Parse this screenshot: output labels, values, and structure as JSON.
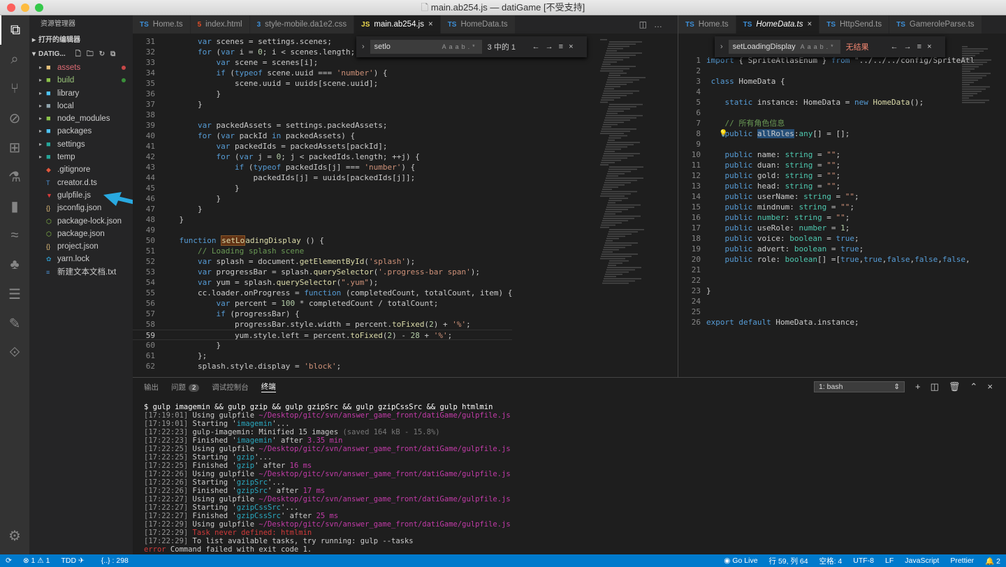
{
  "window": {
    "title": "main.ab254.js — datiGame [不受支持]"
  },
  "sidebar": {
    "title": "资源管理器",
    "open_editors": "打开的编辑器",
    "folder": "DATIG...",
    "items": [
      {
        "label": "assets",
        "type": "folder",
        "color": "#e5c07b",
        "dot": "#c74848"
      },
      {
        "label": "build",
        "type": "folder",
        "color": "#8bc34a",
        "dot": "#3a8f3a"
      },
      {
        "label": "library",
        "type": "folder",
        "color": "#4fc3f7"
      },
      {
        "label": "local",
        "type": "folder",
        "color": "#90a4ae"
      },
      {
        "label": "node_modules",
        "type": "folder",
        "color": "#8bc34a"
      },
      {
        "label": "packages",
        "type": "folder",
        "color": "#4fc3f7"
      },
      {
        "label": "settings",
        "type": "folder",
        "color": "#26a69a"
      },
      {
        "label": "temp",
        "type": "folder",
        "color": "#26a69a"
      },
      {
        "label": ".gitignore",
        "type": "file",
        "icon": "git-icon"
      },
      {
        "label": "creator.d.ts",
        "type": "file",
        "icon": "ts-icon"
      },
      {
        "label": "gulpfile.js",
        "type": "file",
        "icon": "gulp-icon"
      },
      {
        "label": "jsconfig.json",
        "type": "file",
        "icon": "json-icon"
      },
      {
        "label": "package-lock.json",
        "type": "file",
        "icon": "npm-icon"
      },
      {
        "label": "package.json",
        "type": "file",
        "icon": "npm-icon"
      },
      {
        "label": "project.json",
        "type": "file",
        "icon": "json-icon"
      },
      {
        "label": "yarn.lock",
        "type": "file",
        "icon": "yarn-icon"
      },
      {
        "label": "新建文本文档.txt",
        "type": "file",
        "icon": "txt-icon"
      }
    ]
  },
  "editor1": {
    "tabs": [
      {
        "label": "Home.ts",
        "icon": "TS"
      },
      {
        "label": "index.html",
        "icon": "5"
      },
      {
        "label": "style-mobile.da1e2.css",
        "icon": "3"
      },
      {
        "label": "main.ab254.js",
        "icon": "JS",
        "active": true,
        "close": "×"
      },
      {
        "label": "HomeData.ts",
        "icon": "TS"
      }
    ],
    "find": {
      "query": "setlo",
      "aa": "Aa",
      "ab": "ab",
      "re": ".*",
      "count": "3 中的 1",
      "prev": "←",
      "next": "→",
      "menu": "≡",
      "close": "×"
    },
    "lines": [
      {
        "n": "31",
        "code": "        var scenes = settings.scenes;"
      },
      {
        "n": "32",
        "code": "        for (var i = 0; i < scenes.length; ++i) {"
      },
      {
        "n": "33",
        "code": "            var scene = scenes[i];"
      },
      {
        "n": "34",
        "code": "            if (typeof scene.uuid === 'number') {"
      },
      {
        "n": "35",
        "code": "                scene.uuid = uuids[scene.uuid];"
      },
      {
        "n": "36",
        "code": "            }"
      },
      {
        "n": "37",
        "code": "        }"
      },
      {
        "n": "38",
        "code": ""
      },
      {
        "n": "39",
        "code": "        var packedAssets = settings.packedAssets;"
      },
      {
        "n": "40",
        "code": "        for (var packId in packedAssets) {"
      },
      {
        "n": "41",
        "code": "            var packedIds = packedAssets[packId];"
      },
      {
        "n": "42",
        "code": "            for (var j = 0; j < packedIds.length; ++j) {"
      },
      {
        "n": "43",
        "code": "                if (typeof packedIds[j] === 'number') {"
      },
      {
        "n": "44",
        "code": "                    packedIds[j] = uuids[packedIds[j]];"
      },
      {
        "n": "45",
        "code": "                }"
      },
      {
        "n": "46",
        "code": "            }"
      },
      {
        "n": "47",
        "code": "        }"
      },
      {
        "n": "48",
        "code": "    }"
      },
      {
        "n": "49",
        "code": ""
      },
      {
        "n": "50",
        "code": "    function setLoadingDisplay () {"
      },
      {
        "n": "51",
        "code": "        // Loading splash scene"
      },
      {
        "n": "52",
        "code": "        var splash = document.getElementById('splash');"
      },
      {
        "n": "53",
        "code": "        var progressBar = splash.querySelector('.progress-bar span');"
      },
      {
        "n": "54",
        "code": "        var yum = splash.querySelector(\".yum\");"
      },
      {
        "n": "55",
        "code": "        cc.loader.onProgress = function (completedCount, totalCount, item) {"
      },
      {
        "n": "56",
        "code": "            var percent = 100 * completedCount / totalCount;"
      },
      {
        "n": "57",
        "code": "            if (progressBar) {"
      },
      {
        "n": "58",
        "code": "                progressBar.style.width = percent.toFixed(2) + '%';"
      },
      {
        "n": "59",
        "code": "                yum.style.left = percent.toFixed(2) - 28 + '%';"
      },
      {
        "n": "60",
        "code": "            }"
      },
      {
        "n": "61",
        "code": "        };"
      },
      {
        "n": "62",
        "code": "        splash.style.display = 'block';"
      }
    ]
  },
  "editor2": {
    "tabs": [
      {
        "label": "Home.ts",
        "icon": "TS"
      },
      {
        "label": "HomeData.ts",
        "icon": "TS",
        "active": true,
        "close": "×"
      },
      {
        "label": "HttpSend.ts",
        "icon": "TS"
      },
      {
        "label": "GameroleParse.ts",
        "icon": "TS"
      }
    ],
    "find": {
      "query": "setLoadingDisplay",
      "aa": "Aa",
      "ab": "ab",
      "re": ".*",
      "count": "无结果",
      "prev": "←",
      "next": "→",
      "menu": "≡",
      "close": "×"
    },
    "lines": [
      {
        "n": "1",
        "code": "import { SpriteAtlasEnum } from \"../../../config/SpriteAtl"
      },
      {
        "n": "2",
        "code": ""
      },
      {
        "n": "3",
        "code": " class HomeData {"
      },
      {
        "n": "4",
        "code": ""
      },
      {
        "n": "5",
        "code": "    static instance: HomeData = new HomeData();"
      },
      {
        "n": "6",
        "code": ""
      },
      {
        "n": "7",
        "code": "    // 所有角色信息"
      },
      {
        "n": "8",
        "code": "    public allRoles:any[] = [];"
      },
      {
        "n": "9",
        "code": ""
      },
      {
        "n": "10",
        "code": "    public name: string = \"\";"
      },
      {
        "n": "11",
        "code": "    public duan: string = \"\";"
      },
      {
        "n": "12",
        "code": "    public gold: string = \"\";"
      },
      {
        "n": "13",
        "code": "    public head: string = \"\";"
      },
      {
        "n": "14",
        "code": "    public userName: string = \"\";"
      },
      {
        "n": "15",
        "code": "    public mindnum: string = \"\";"
      },
      {
        "n": "16",
        "code": "    public number: string = \"\";"
      },
      {
        "n": "17",
        "code": "    public useRole: number = 1;"
      },
      {
        "n": "18",
        "code": "    public voice: boolean = true;"
      },
      {
        "n": "19",
        "code": "    public advert: boolean = true;"
      },
      {
        "n": "20",
        "code": "    public role: boolean[] =[true,true,false,false,false,"
      },
      {
        "n": "21",
        "code": ""
      },
      {
        "n": "22",
        "code": ""
      },
      {
        "n": "23",
        "code": "}"
      },
      {
        "n": "24",
        "code": ""
      },
      {
        "n": "25",
        "code": ""
      },
      {
        "n": "26",
        "code": "export default HomeData.instance;"
      }
    ]
  },
  "panel": {
    "tabs": [
      "输出",
      "问题",
      "调试控制台",
      "终端"
    ],
    "problems_count": "2",
    "terminal_select": "1: bash",
    "terminal": [
      {
        "ts": "",
        "text": "$ gulp imagemin && gulp gzip && gulp gzipSrc && gulp gzipCssSrc && gulp htmlmin",
        "kind": "cmd"
      },
      {
        "ts": "[17:19:01]",
        "text": " Using gulpfile ",
        "path": "~/Desktop/gitc/svn/answer_game_front/datiGame/gulpfile.js"
      },
      {
        "ts": "[17:19:01]",
        "text": " Starting '",
        "task": "imagemin",
        "tail": "'..."
      },
      {
        "ts": "[17:22:23]",
        "text": " gulp-imagemin: Minified 15 images ",
        "note": "(saved 164 kB - 15.8%)"
      },
      {
        "ts": "[17:22:23]",
        "text": " Finished '",
        "task": "imagemin",
        "tail": "' after ",
        "time": "3.35 min"
      },
      {
        "ts": "[17:22:25]",
        "text": " Using gulpfile ",
        "path": "~/Desktop/gitc/svn/answer_game_front/datiGame/gulpfile.js"
      },
      {
        "ts": "[17:22:25]",
        "text": " Starting '",
        "task": "gzip",
        "tail": "'..."
      },
      {
        "ts": "[17:22:25]",
        "text": " Finished '",
        "task": "gzip",
        "tail": "' after ",
        "time": "16 ms"
      },
      {
        "ts": "[17:22:26]",
        "text": " Using gulpfile ",
        "path": "~/Desktop/gitc/svn/answer_game_front/datiGame/gulpfile.js"
      },
      {
        "ts": "[17:22:26]",
        "text": " Starting '",
        "task": "gzipSrc",
        "tail": "'..."
      },
      {
        "ts": "[17:22:26]",
        "text": " Finished '",
        "task": "gzipSrc",
        "tail": "' after ",
        "time": "17 ms"
      },
      {
        "ts": "[17:22:27]",
        "text": " Using gulpfile ",
        "path": "~/Desktop/gitc/svn/answer_game_front/datiGame/gulpfile.js"
      },
      {
        "ts": "[17:22:27]",
        "text": " Starting '",
        "task": "gzipCssSrc",
        "tail": "'..."
      },
      {
        "ts": "[17:22:27]",
        "text": " Finished '",
        "task": "gzipCssSrc",
        "tail": "' after ",
        "time": "25 ms"
      },
      {
        "ts": "[17:22:29]",
        "text": " Using gulpfile ",
        "path": "~/Desktop/gitc/svn/answer_game_front/datiGame/gulpfile.js"
      },
      {
        "ts": "[17:22:29]",
        "text": " ",
        "err": "Task never defined: htmlmin"
      },
      {
        "ts": "[17:22:29]",
        "text": " To list available tasks, try running: gulp --tasks"
      },
      {
        "ts": "",
        "text": " Command failed with exit code 1.",
        "prefix": "error",
        "kind": "error"
      }
    ]
  },
  "statusbar": {
    "errors": "⊗ 1 ⚠ 1",
    "tdd": "TDD ✈",
    "braces": "{..} : 298",
    "golive": "◉ Go Live",
    "position": "行 59, 列 64",
    "spaces": "空格: 4",
    "encoding": "UTF-8",
    "eol": "LF",
    "language": "JavaScript",
    "formatter": "Prettier",
    "notifications": "🔔 2"
  },
  "colors": {
    "accent": "#007acc",
    "annotation_arrow": "#29a9e0"
  }
}
